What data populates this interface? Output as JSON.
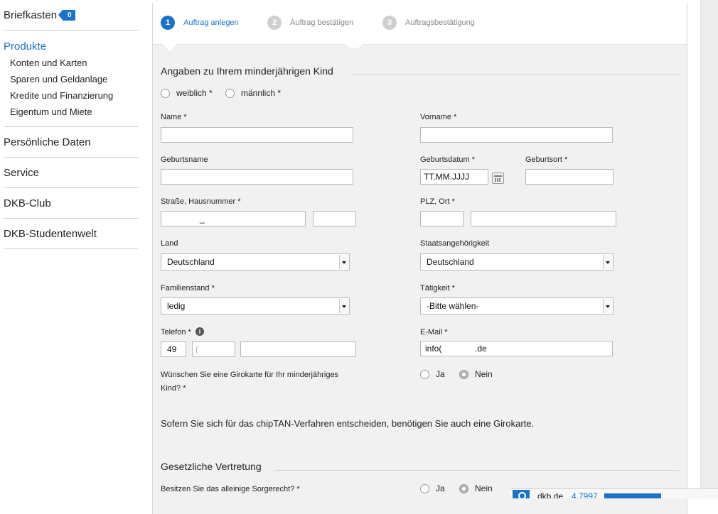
{
  "sidebar": {
    "mailbox": {
      "label": "Briefkasten",
      "count": "0"
    },
    "sections": [
      {
        "label": "Produkte",
        "active": true,
        "items": [
          "Konten und Karten",
          "Sparen und Geldanlage",
          "Kredite und Finanzierung",
          "Eigentum und Miete"
        ]
      },
      {
        "label": "Persönliche Daten"
      },
      {
        "label": "Service"
      },
      {
        "label": "DKB-Club"
      },
      {
        "label": "DKB-Studentenwelt"
      }
    ]
  },
  "steps": [
    {
      "number": "1",
      "label": "Auftrag anlegen",
      "active": true
    },
    {
      "number": "2",
      "label": "Auftrag bestätigen",
      "active": false
    },
    {
      "number": "3",
      "label": "Auftragsbestätigung",
      "active": false
    }
  ],
  "section_child": {
    "title": "Angaben zu Ihrem minderjährigen Kind",
    "gender": {
      "female": "weiblich *",
      "male": "männlich *"
    },
    "name_label": "Name *",
    "name_value": "",
    "firstname_label": "Vorname *",
    "firstname_value": "",
    "birthname_label": "Geburtsname",
    "birthname_value": "",
    "birthdate_label": "Geburtsdatum *",
    "birthdate_value": "TT.MM.JJJJ",
    "birthplace_label": "Geburtsort *",
    "birthplace_value": "",
    "street_label": "Straße, Hausnummer *",
    "street_value": "_",
    "housenumber_value": "",
    "zipcity_label": "PLZ, Ort *",
    "zip_value": "",
    "city_value": "",
    "country_label": "Land",
    "country_value": "Deutschland",
    "nationality_label": "Staatsangehörigkeit",
    "nationality_value": "Deutschland",
    "marital_label": "Familienstand *",
    "marital_value": "ledig",
    "occupation_label": "Tätigkeit *",
    "occupation_value": "-Bitte wählen-",
    "phone_label": "Telefon *",
    "phone_info": "i",
    "phone_country": "49",
    "phone_area": "(",
    "phone_number": "",
    "email_label": "E-Mail *",
    "email_value": "info(              .de",
    "girocard_question": "Wünschen Sie eine Girokarte für Ihr minderjähriges Kind? *",
    "girocard_yes": "Ja",
    "girocard_no": "Nein",
    "chiptan_note": "Sofern Sie sich für das chipTAN-Verfahren entscheiden, benötigen Sie auch eine Girokarte."
  },
  "section_legal": {
    "title": "Gesetzliche Vertretung",
    "custody_question": "Besitzen Sie das alleinige Sorgerecht? *",
    "custody_yes": "Ja",
    "custody_no": "Nein"
  },
  "popup": {
    "site": "dkb.de",
    "number": "4.7997"
  },
  "colors": {
    "accent": "#1a73c7",
    "panel_bg": "#f1f1f1"
  }
}
